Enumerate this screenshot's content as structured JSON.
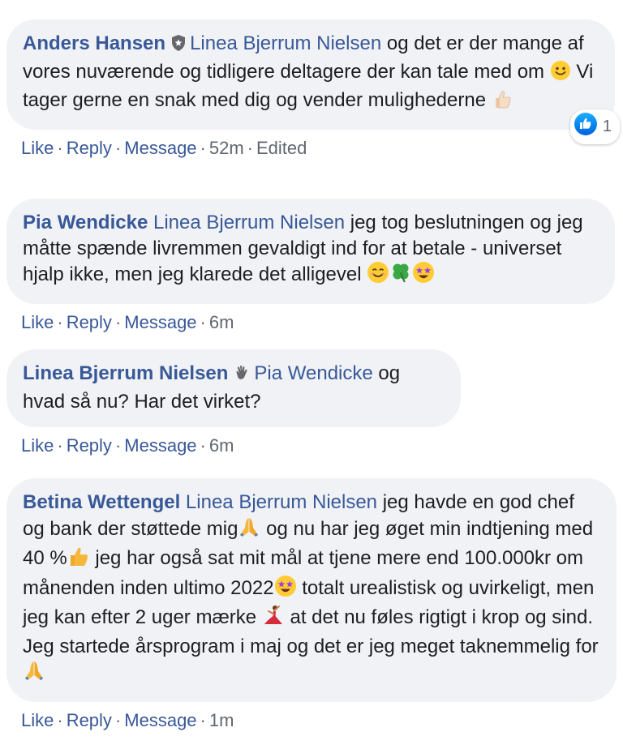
{
  "actions": {
    "like": "Like",
    "reply": "Reply",
    "message": "Message",
    "sep": "·"
  },
  "comments": [
    {
      "author": "Anders Hansen",
      "mention": "Linea Bjerrum Nielsen",
      "text_1": " og det er der mange af vores nuværende og tidligere deltagere der kan tale med om ",
      "text_2": " Vi tager gerne en snak med dig og vender mulighederne ",
      "time": "52m",
      "edited": "Edited",
      "reaction_count": "1"
    },
    {
      "author": "Pia Wendicke",
      "mention": "Linea Bjerrum Nielsen",
      "text_1": " jeg tog beslutningen og jeg måtte spænde livremmen gevaldigt ind for at betale - universet hjalp ikke, men jeg klarede det alligevel ",
      "time": "6m"
    },
    {
      "author": "Linea Bjerrum Nielsen",
      "mention": "Pia Wendicke",
      "text_1": " og hvad så nu? Har det virket?",
      "time": "6m"
    },
    {
      "author": "Betina Wettengel",
      "mention": "Linea Bjerrum Nielsen",
      "text_1": " jeg havde en god chef og bank der støttede mig",
      "text_2": "  og nu har jeg øget min indtjening med 40 %",
      "text_3": "  jeg har også sat mit mål at tjene mere end 100.000kr om månenden inden ultimo 2022",
      "text_4": " totalt urealistisk og uvirkeligt, men jeg kan efter 2 uger mærke ",
      "text_5": " at det nu føles rigtigt i krop og sind.",
      "text_6": "Jeg startede årsprogram i maj og det er jeg meget taknemmelig for",
      "time": "1m"
    }
  ]
}
